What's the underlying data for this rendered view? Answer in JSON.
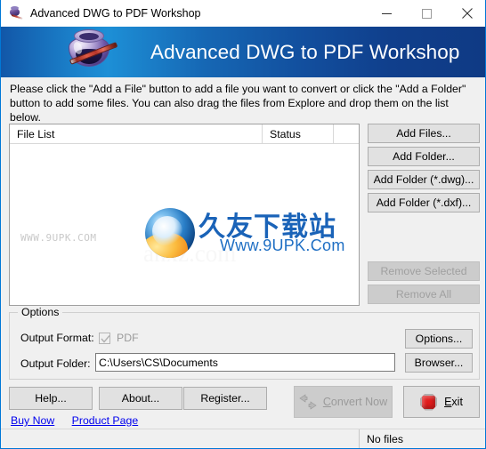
{
  "window": {
    "title": "Advanced DWG to PDF Workshop",
    "icon": "inkwell-pen-icon",
    "minimize_label": "—",
    "maximize_label": "□",
    "close_label": "✕"
  },
  "banner": {
    "title": "Advanced DWG to PDF Workshop",
    "logo": "inkwell-pen-logo",
    "gradient_from": "#1257a8",
    "gradient_mid": "#1d8fd6",
    "gradient_to": "#0f3a84"
  },
  "instructions": {
    "line1": "Please click the \"Add a File\" button to add a file you want to convert or click the \"Add a Folder\"",
    "line2": "button to add some files. You can also drag the files from Explore and drop them on the list below."
  },
  "file_list": {
    "columns": [
      "File List",
      "Status",
      ""
    ],
    "rows": [],
    "watermark": {
      "faint_text": "WWW.9UPK.COM",
      "ghost_text": "anxz.com",
      "chinese_text": "久友下载站",
      "url_text": "Www.9UPK.Com",
      "logo": "globe-swirl-icon"
    }
  },
  "add_buttons": [
    {
      "label": "Add Files...",
      "name": "add-files-button",
      "disabled": false
    },
    {
      "label": "Add Folder...",
      "name": "add-folder-button",
      "disabled": false
    },
    {
      "label": "Add Folder (*.dwg)...",
      "name": "add-folder-dwg-button",
      "disabled": false
    },
    {
      "label": "Add Folder (*.dxf)...",
      "name": "add-folder-dxf-button",
      "disabled": false
    }
  ],
  "remove_buttons": [
    {
      "label": "Remove Selected",
      "name": "remove-selected-button",
      "disabled": true
    },
    {
      "label": "Remove All",
      "name": "remove-all-button",
      "disabled": true
    }
  ],
  "options": {
    "group_title": "Options",
    "output_format_label": "Output Format:",
    "output_format_value": "PDF",
    "output_format_checked": true,
    "output_format_enabled": false,
    "output_folder_label": "Output Folder:",
    "output_folder_value": "C:\\Users\\CS\\Documents",
    "options_button": "Options...",
    "browser_button": "Browser..."
  },
  "bottom": {
    "help_button": "Help...",
    "about_button": "About...",
    "register_button": "Register...",
    "convert_button": "Convert Now",
    "convert_accel": "C",
    "convert_rest": "onvert Now",
    "convert_disabled": true,
    "exit_button": "Exit",
    "exit_accel": "E",
    "exit_rest": "xit",
    "links": [
      {
        "label": "Buy Now",
        "name": "buy-now-link"
      },
      {
        "label": "Product Page",
        "name": "product-page-link"
      }
    ]
  },
  "statusbar": {
    "left_text": "",
    "right_text": "No files"
  }
}
